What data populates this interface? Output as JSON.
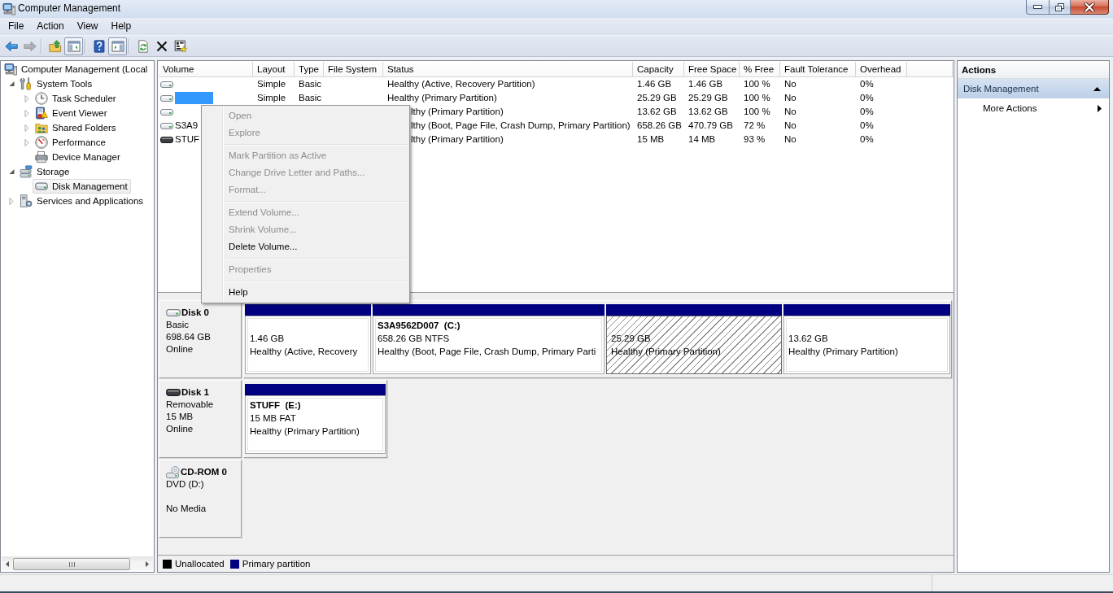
{
  "window": {
    "title": "Computer Management"
  },
  "menu_bar": [
    "File",
    "Action",
    "View",
    "Help"
  ],
  "toolbar": [
    [
      {
        "kind": "back",
        "disabled": false,
        "pressed": false
      },
      {
        "kind": "forward",
        "disabled": true,
        "pressed": false
      }
    ],
    [
      {
        "kind": "up",
        "disabled": false,
        "pressed": false
      },
      {
        "kind": "console_tree",
        "disabled": false,
        "pressed": true
      }
    ],
    [
      {
        "kind": "help",
        "disabled": false,
        "pressed": false
      },
      {
        "kind": "action_pane",
        "disabled": false,
        "pressed": true
      }
    ],
    [
      {
        "kind": "refresh",
        "disabled": false,
        "pressed": false
      },
      {
        "kind": "delete",
        "disabled": false,
        "pressed": false
      },
      {
        "kind": "properties",
        "disabled": false,
        "pressed": false
      }
    ]
  ],
  "console_tree": [
    {
      "label": "Computer Management (Local",
      "kind": "computer",
      "selected": false,
      "children": [
        {
          "label": "System Tools",
          "kind": "tools",
          "expanded": true,
          "selected": false,
          "children": [
            {
              "label": "Task Scheduler",
              "kind": "scheduler",
              "expanded": false,
              "selected": false
            },
            {
              "label": "Event Viewer",
              "kind": "events",
              "expanded": false,
              "selected": false
            },
            {
              "label": "Shared Folders",
              "kind": "shares",
              "expanded": false,
              "selected": false
            },
            {
              "label": "Performance",
              "kind": "performance",
              "expanded": false,
              "selected": false
            },
            {
              "label": "Device Manager",
              "kind": "devices",
              "selected": false
            }
          ]
        },
        {
          "label": "Storage",
          "kind": "storage",
          "expanded": true,
          "selected": false,
          "children": [
            {
              "label": "Disk Management",
              "kind": "disks",
              "selected": true
            }
          ]
        },
        {
          "label": "Services and Applications",
          "kind": "services",
          "expanded": false,
          "selected": false
        }
      ]
    }
  ],
  "volume_list": {
    "columns": [
      "Volume",
      "Layout",
      "Type",
      "File System",
      "Status",
      "Capacity",
      "Free Space",
      "% Free",
      "Fault Tolerance",
      "Overhead"
    ],
    "rows": [
      {
        "kind": "fixed",
        "selected": false,
        "layout": "Simple",
        "type": "Basic",
        "status": "Healthy (Active, Recovery Partition)",
        "capacity": "1.46 GB",
        "free_space": "1.46 GB",
        "percent_free": "100 %",
        "fault_tolerance": "No",
        "overhead": "0%"
      },
      {
        "kind": "fixed",
        "selected": true,
        "layout": "Simple",
        "type": "Basic",
        "status": "Healthy (Primary Partition)",
        "capacity": "25.29 GB",
        "free_space": "25.29 GB",
        "percent_free": "100 %",
        "fault_tolerance": "No",
        "overhead": "0%"
      },
      {
        "kind": "fixed",
        "selected": false,
        "status": "lthy (Primary Partition)",
        "capacity": "13.62 GB",
        "free_space": "13.62 GB",
        "percent_free": "100 %",
        "fault_tolerance": "No",
        "overhead": "0%"
      },
      {
        "kind": "fixed",
        "selected": false,
        "volume": "S3A9",
        "status": "lthy (Boot, Page File, Crash Dump, Primary Partition)",
        "capacity": "658.26 GB",
        "free_space": "470.79 GB",
        "percent_free": "72 %",
        "fault_tolerance": "No",
        "overhead": "0%"
      },
      {
        "kind": "removable",
        "selected": false,
        "volume": "STUF",
        "status": "lthy (Primary Partition)",
        "capacity": "15 MB",
        "free_space": "14 MB",
        "percent_free": "93 %",
        "fault_tolerance": "No",
        "overhead": "0%"
      }
    ]
  },
  "context_menu": {
    "groups": [
      [
        {
          "label": "Open",
          "disabled": true
        },
        {
          "label": "Explore",
          "disabled": true
        }
      ],
      [
        {
          "label": "Mark Partition as Active",
          "disabled": true
        },
        {
          "label": "Change Drive Letter and Paths...",
          "disabled": true
        },
        {
          "label": "Format...",
          "disabled": true
        }
      ],
      [
        {
          "label": "Extend Volume...",
          "disabled": true
        },
        {
          "label": "Shrink Volume...",
          "disabled": true
        },
        {
          "label": "Delete Volume...",
          "disabled": false
        }
      ],
      [
        {
          "label": "Properties",
          "disabled": true
        }
      ],
      [
        {
          "label": "Help",
          "disabled": false
        }
      ]
    ]
  },
  "disk_map": {
    "disks": [
      {
        "kind": "basic",
        "name": "Disk 0",
        "type": "Basic",
        "size": "698.64 GB",
        "status": "Online",
        "partitions": [
          {
            "selected": false,
            "size": "1.46 GB",
            "status": "Healthy (Active, Recovery"
          },
          {
            "selected": false,
            "title": "S3A9562D007  (C:)",
            "size": "658.26 GB NTFS",
            "status": "Healthy (Boot, Page File, Crash Dump, Primary Parti"
          },
          {
            "selected": true,
            "size": "25.29 GB",
            "status": "Healthy (Primary Partition)"
          },
          {
            "selected": false,
            "size": "13.62 GB",
            "status": "Healthy (Primary Partition)"
          }
        ]
      },
      {
        "kind": "removable",
        "name": "Disk 1",
        "type": "Removable",
        "size": "15 MB",
        "status": "Online",
        "partitions": [
          {
            "selected": false,
            "title": "STUFF  (E:)",
            "size": "15 MB FAT",
            "status": "Healthy (Primary Partition)"
          }
        ]
      },
      {
        "kind": "cdrom",
        "name": "CD-ROM 0",
        "type": "DVD (D:)",
        "status": "No Media"
      }
    ],
    "legend": [
      {
        "label": "Unallocated",
        "color": "#000000"
      },
      {
        "label": "Primary partition",
        "color": "#000080"
      }
    ]
  },
  "actions_pane": {
    "title": "Actions",
    "sections": [
      {
        "title": "Disk Management",
        "expanded": true,
        "items": [
          {
            "label": "More Actions",
            "submenu": true
          }
        ]
      }
    ]
  }
}
